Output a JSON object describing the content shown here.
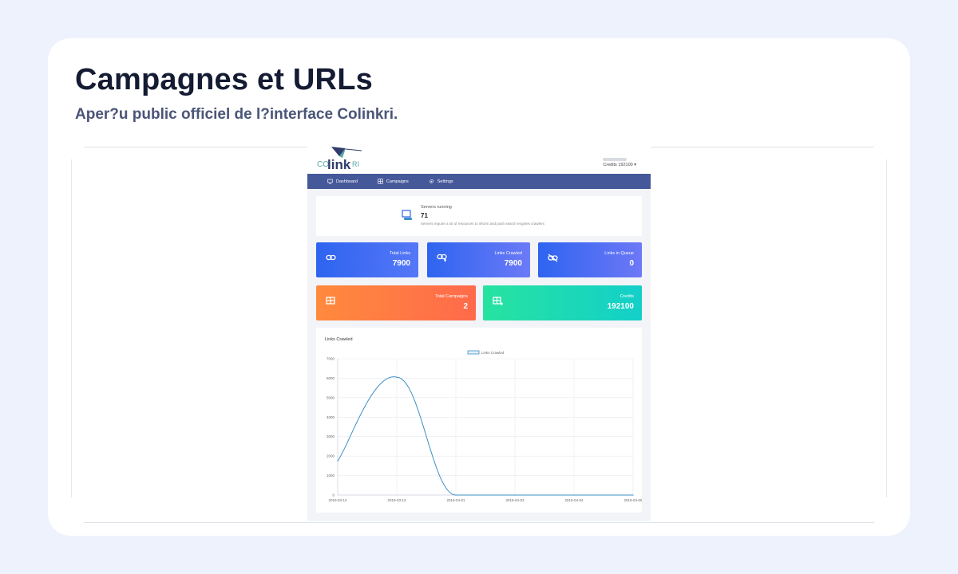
{
  "page": {
    "title": "Campagnes et URLs",
    "subtitle": "Aper?u public officiel de l?interface Colinkri."
  },
  "app": {
    "logo": {
      "co": "CO",
      "link": "link",
      "ri": "RI"
    },
    "header": {
      "credits_label": "Credits 192100"
    },
    "nav": [
      {
        "label": "Dashboard",
        "icon": "monitor-icon"
      },
      {
        "label": "Campaigns",
        "icon": "table-icon"
      },
      {
        "label": "Settings",
        "icon": "gear-icon"
      }
    ],
    "servers": {
      "label": "Servers running",
      "value": "71",
      "description": "Servers require a lot of resources to inform and push search engines crawlers"
    },
    "stats": [
      {
        "label": "Total Links",
        "value": "7900",
        "icon": "link-icon"
      },
      {
        "label": "Links Crawled",
        "value": "7900",
        "icon": "link-crawled-icon"
      },
      {
        "label": "Links in Queue",
        "value": "0",
        "icon": "link-off-icon"
      },
      {
        "label": "Total Campaigns",
        "value": "2",
        "icon": "table-icon"
      },
      {
        "label": "Credits",
        "value": "192100",
        "icon": "table-add-icon"
      }
    ],
    "colors": {
      "nav": "#45589a",
      "blue": "#2e64f0",
      "orange": "#ff7a45",
      "green": "#1fdab3",
      "line": "#3d8fc4"
    }
  },
  "chart_data": {
    "type": "line",
    "title": "Links Crawled",
    "x": [
      "2019-03-12",
      "2019-03-13",
      "2019-04-01",
      "2019-04-03",
      "2019-04-04",
      "2019-04-05"
    ],
    "series": [
      {
        "name": "Links Crawled",
        "values": [
          1750,
          6050,
          0,
          0,
          0,
          0
        ]
      }
    ],
    "yticks": [
      0,
      1000,
      2000,
      3000,
      4000,
      5000,
      6000,
      7000
    ],
    "ylim": [
      0,
      7000
    ],
    "grid": true,
    "legend": "top-center"
  }
}
